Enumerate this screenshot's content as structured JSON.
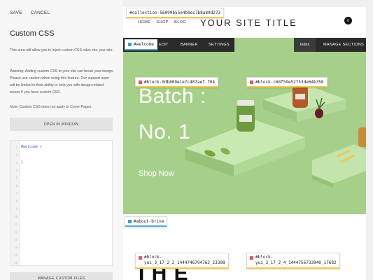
{
  "panel": {
    "save_label": "SAVE",
    "cancel_label": "CANCEL",
    "title": "Custom CSS",
    "intro": "This area will allow you to inject custom CSS rules into your site.",
    "warning": "Warning: Adding custom CSS to your site can break your design. Please use caution when using this feature. Our support team will be limited in their ability to help you with design related issues if you have custom CSS.",
    "note": "Note: Custom CSS does not apply to Cover Pages.",
    "open_window_label": "OPEN IN WINDOW",
    "manage_files_label": "MANAGE CUSTOM FILES",
    "editor": {
      "line_numbers": [
        "1",
        "2",
        "3",
        "4",
        "5",
        "6",
        "7",
        "8",
        "9",
        "10",
        "11",
        "12",
        "13",
        "14",
        "15",
        "16"
      ],
      "lines": [
        "#welcome {",
        "",
        "}"
      ]
    }
  },
  "site": {
    "nav": [
      "HOME",
      "SHOP",
      "BLOG"
    ],
    "title": "YOUR SITE TITLE",
    "cart_count": "0",
    "hero": {
      "line1": "Batch :",
      "line2": "No. 1",
      "link": "Shop Now",
      "bg_color": "#a6d089"
    },
    "about_heading_fragment": "I H E"
  },
  "editbar": {
    "edit_label": "EDIT",
    "banner_label": "BANNER",
    "settings_label": "SETTINGS",
    "index_label": "Index",
    "manage_sections_label": "MANAGE SECTIONS"
  },
  "tags": {
    "collection": "#collection-56099b55e4b0ec7b8a89d273",
    "welcome": "#welcome",
    "block1": "#block-0db809e1e7c407aef f04",
    "block2": "#block-c68f59e52753de64b358",
    "about": "#about-brine",
    "block3_line1": "#block-",
    "block3_line2": "yui_3_17_2_2_1444746794763_23308",
    "block4_line1": "#block-",
    "block4_line2": "yui_3_17_2_4_1444756733940_17682"
  },
  "colors": {
    "tag_swatch": "#e0566f",
    "tag_swatch_alt": "#3a9fbf",
    "editbar": "#2a2a2a",
    "hero": "#a6d089"
  }
}
